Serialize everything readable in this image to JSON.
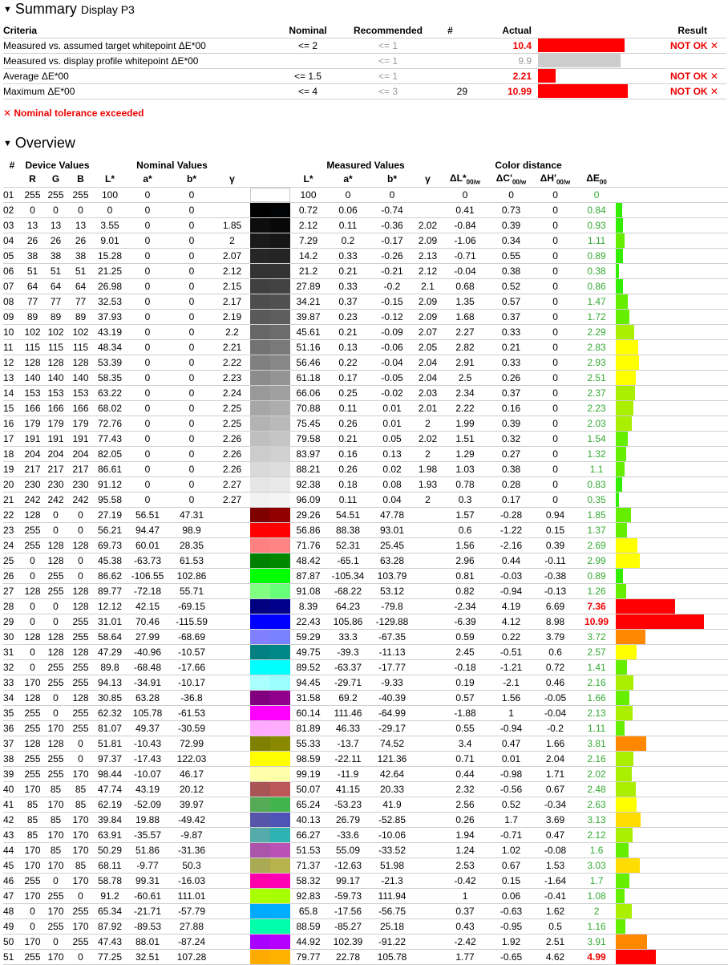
{
  "summary": {
    "title": "Summary",
    "subtitle": "Display P3",
    "headers": {
      "criteria": "Criteria",
      "nominal": "Nominal",
      "recommended": "Recommended",
      "count": "#",
      "actual": "Actual",
      "result": "Result"
    },
    "rows": [
      {
        "criteria": "Measured vs. assumed target whitepoint ΔE*00",
        "nominal": "<= 2",
        "recommended": "<= 1",
        "count": "",
        "actual": "10.4",
        "actual_status": "bad",
        "bar_color": "#ff0000",
        "bar_fraction": 0.96,
        "swatch": "",
        "result": "NOT OK ✕"
      },
      {
        "criteria": "Measured vs. display profile whitepoint ΔE*00",
        "nominal": "",
        "recommended": "<= 1",
        "count": "",
        "actual": "9.9",
        "actual_status": "muted",
        "bar_color": "#cccccc",
        "bar_fraction": 0.92,
        "swatch": "",
        "result": ""
      },
      {
        "criteria": "Average ΔE*00",
        "nominal": "<= 1.5",
        "recommended": "<= 1",
        "count": "",
        "actual": "2.21",
        "actual_status": "bad",
        "bar_color": "#ff0000",
        "bar_fraction": 0.2,
        "swatch": "",
        "result": "NOT OK ✕"
      },
      {
        "criteria": "Maximum ΔE*00",
        "nominal": "<= 4",
        "recommended": "<= 3",
        "count": "29",
        "actual": "10.99",
        "actual_status": "bad",
        "bar_color": "#ff0000",
        "bar_fraction": 1.0,
        "swatch": "blue",
        "result": "NOT OK ✕"
      }
    ],
    "note": "✕ Nominal tolerance exceeded"
  },
  "overview": {
    "title": "Overview",
    "groups": {
      "num": "#",
      "device": "Device Values",
      "nominal": "Nominal Values",
      "measured": "Measured Values",
      "distance": "Color distance"
    },
    "columns": {
      "r": "R",
      "g": "G",
      "b": "B",
      "nl": "L*",
      "na": "a*",
      "nb": "b*",
      "gamma": "γ",
      "ml": "L*",
      "ma": "a*",
      "mb": "b*",
      "mgamma": "γ",
      "dl": "ΔL*",
      "dc": "ΔC'",
      "dh": "ΔH'",
      "de": "ΔE",
      "sub_ow": "00/w",
      "sub_00": "00"
    },
    "rows": [
      [
        "01",
        "255",
        "255",
        "255",
        "100",
        "0",
        "0",
        "",
        "100",
        "0",
        "0",
        "",
        "0",
        "0",
        "0",
        "0"
      ],
      [
        "02",
        "0",
        "0",
        "0",
        "0",
        "0",
        "0",
        "",
        "0.72",
        "0.06",
        "-0.74",
        "",
        "0.41",
        "0.73",
        "0",
        "0.84"
      ],
      [
        "03",
        "13",
        "13",
        "13",
        "3.55",
        "0",
        "0",
        "1.85",
        "2.12",
        "0.11",
        "-0.36",
        "2.02",
        "-0.84",
        "0.39",
        "0",
        "0.93"
      ],
      [
        "04",
        "26",
        "26",
        "26",
        "9.01",
        "0",
        "0",
        "2",
        "7.29",
        "0.2",
        "-0.17",
        "2.09",
        "-1.06",
        "0.34",
        "0",
        "1.11"
      ],
      [
        "05",
        "38",
        "38",
        "38",
        "15.28",
        "0",
        "0",
        "2.07",
        "14.2",
        "0.33",
        "-0.26",
        "2.13",
        "-0.71",
        "0.55",
        "0",
        "0.89"
      ],
      [
        "06",
        "51",
        "51",
        "51",
        "21.25",
        "0",
        "0",
        "2.12",
        "21.2",
        "0.21",
        "-0.21",
        "2.12",
        "-0.04",
        "0.38",
        "0",
        "0.38"
      ],
      [
        "07",
        "64",
        "64",
        "64",
        "26.98",
        "0",
        "0",
        "2.15",
        "27.89",
        "0.33",
        "-0.2",
        "2.1",
        "0.68",
        "0.52",
        "0",
        "0.86"
      ],
      [
        "08",
        "77",
        "77",
        "77",
        "32.53",
        "0",
        "0",
        "2.17",
        "34.21",
        "0.37",
        "-0.15",
        "2.09",
        "1.35",
        "0.57",
        "0",
        "1.47"
      ],
      [
        "09",
        "89",
        "89",
        "89",
        "37.93",
        "0",
        "0",
        "2.19",
        "39.87",
        "0.23",
        "-0.12",
        "2.09",
        "1.68",
        "0.37",
        "0",
        "1.72"
      ],
      [
        "10",
        "102",
        "102",
        "102",
        "43.19",
        "0",
        "0",
        "2.2",
        "45.61",
        "0.21",
        "-0.09",
        "2.07",
        "2.27",
        "0.33",
        "0",
        "2.29"
      ],
      [
        "11",
        "115",
        "115",
        "115",
        "48.34",
        "0",
        "0",
        "2.21",
        "51.16",
        "0.13",
        "-0.06",
        "2.05",
        "2.82",
        "0.21",
        "0",
        "2.83"
      ],
      [
        "12",
        "128",
        "128",
        "128",
        "53.39",
        "0",
        "0",
        "2.22",
        "56.46",
        "0.22",
        "-0.04",
        "2.04",
        "2.91",
        "0.33",
        "0",
        "2.93"
      ],
      [
        "13",
        "140",
        "140",
        "140",
        "58.35",
        "0",
        "0",
        "2.23",
        "61.18",
        "0.17",
        "-0.05",
        "2.04",
        "2.5",
        "0.26",
        "0",
        "2.51"
      ],
      [
        "14",
        "153",
        "153",
        "153",
        "63.22",
        "0",
        "0",
        "2.24",
        "66.06",
        "0.25",
        "-0.02",
        "2.03",
        "2.34",
        "0.37",
        "0",
        "2.37"
      ],
      [
        "15",
        "166",
        "166",
        "166",
        "68.02",
        "0",
        "0",
        "2.25",
        "70.88",
        "0.11",
        "0.01",
        "2.01",
        "2.22",
        "0.16",
        "0",
        "2.23"
      ],
      [
        "16",
        "179",
        "179",
        "179",
        "72.76",
        "0",
        "0",
        "2.25",
        "75.45",
        "0.26",
        "0.01",
        "2",
        "1.99",
        "0.39",
        "0",
        "2.03"
      ],
      [
        "17",
        "191",
        "191",
        "191",
        "77.43",
        "0",
        "0",
        "2.26",
        "79.58",
        "0.21",
        "0.05",
        "2.02",
        "1.51",
        "0.32",
        "0",
        "1.54"
      ],
      [
        "18",
        "204",
        "204",
        "204",
        "82.05",
        "0",
        "0",
        "2.26",
        "83.97",
        "0.16",
        "0.13",
        "2",
        "1.29",
        "0.27",
        "0",
        "1.32"
      ],
      [
        "19",
        "217",
        "217",
        "217",
        "86.61",
        "0",
        "0",
        "2.26",
        "88.21",
        "0.26",
        "0.02",
        "1.98",
        "1.03",
        "0.38",
        "0",
        "1.1"
      ],
      [
        "20",
        "230",
        "230",
        "230",
        "91.12",
        "0",
        "0",
        "2.27",
        "92.38",
        "0.18",
        "0.08",
        "1.93",
        "0.78",
        "0.28",
        "0",
        "0.83"
      ],
      [
        "21",
        "242",
        "242",
        "242",
        "95.58",
        "0",
        "0",
        "2.27",
        "96.09",
        "0.11",
        "0.04",
        "2",
        "0.3",
        "0.17",
        "0",
        "0.35"
      ],
      [
        "22",
        "128",
        "0",
        "0",
        "27.19",
        "56.51",
        "47.31",
        "",
        "29.26",
        "54.51",
        "47.78",
        "",
        "1.57",
        "-0.28",
        "0.94",
        "1.85"
      ],
      [
        "23",
        "255",
        "0",
        "0",
        "56.21",
        "94.47",
        "98.9",
        "",
        "56.86",
        "88.38",
        "93.01",
        "",
        "0.6",
        "-1.22",
        "0.15",
        "1.37"
      ],
      [
        "24",
        "255",
        "128",
        "128",
        "69.73",
        "60.01",
        "28.35",
        "",
        "71.76",
        "52.31",
        "25.45",
        "",
        "1.56",
        "-2.16",
        "0.39",
        "2.69"
      ],
      [
        "25",
        "0",
        "128",
        "0",
        "45.38",
        "-63.73",
        "61.53",
        "",
        "48.42",
        "-65.1",
        "63.28",
        "",
        "2.96",
        "0.44",
        "-0.11",
        "2.99"
      ],
      [
        "26",
        "0",
        "255",
        "0",
        "86.62",
        "-106.55",
        "102.86",
        "",
        "87.87",
        "-105.34",
        "103.79",
        "",
        "0.81",
        "-0.03",
        "-0.38",
        "0.89"
      ],
      [
        "27",
        "128",
        "255",
        "128",
        "89.77",
        "-72.18",
        "55.71",
        "",
        "91.08",
        "-68.22",
        "53.12",
        "",
        "0.82",
        "-0.94",
        "-0.13",
        "1.26"
      ],
      [
        "28",
        "0",
        "0",
        "128",
        "12.12",
        "42.15",
        "-69.15",
        "",
        "8.39",
        "64.23",
        "-79.8",
        "",
        "-2.34",
        "4.19",
        "6.69",
        "7.36"
      ],
      [
        "29",
        "0",
        "0",
        "255",
        "31.01",
        "70.46",
        "-115.59",
        "",
        "22.43",
        "105.86",
        "-129.88",
        "",
        "-6.39",
        "4.12",
        "8.98",
        "10.99"
      ],
      [
        "30",
        "128",
        "128",
        "255",
        "58.64",
        "27.99",
        "-68.69",
        "",
        "59.29",
        "33.3",
        "-67.35",
        "",
        "0.59",
        "0.22",
        "3.79",
        "3.72"
      ],
      [
        "31",
        "0",
        "128",
        "128",
        "47.29",
        "-40.96",
        "-10.57",
        "",
        "49.75",
        "-39.3",
        "-11.13",
        "",
        "2.45",
        "-0.51",
        "0.6",
        "2.57"
      ],
      [
        "32",
        "0",
        "255",
        "255",
        "89.8",
        "-68.48",
        "-17.66",
        "",
        "89.52",
        "-63.37",
        "-17.77",
        "",
        "-0.18",
        "-1.21",
        "0.72",
        "1.41"
      ],
      [
        "33",
        "170",
        "255",
        "255",
        "94.13",
        "-34.91",
        "-10.17",
        "",
        "94.45",
        "-29.71",
        "-9.33",
        "",
        "0.19",
        "-2.1",
        "0.46",
        "2.16"
      ],
      [
        "34",
        "128",
        "0",
        "128",
        "30.85",
        "63.28",
        "-36.8",
        "",
        "31.58",
        "69.2",
        "-40.39",
        "",
        "0.57",
        "1.56",
        "-0.05",
        "1.66"
      ],
      [
        "35",
        "255",
        "0",
        "255",
        "62.32",
        "105.78",
        "-61.53",
        "",
        "60.14",
        "111.46",
        "-64.99",
        "",
        "-1.88",
        "1",
        "-0.04",
        "2.13"
      ],
      [
        "36",
        "255",
        "170",
        "255",
        "81.07",
        "49.37",
        "-30.59",
        "",
        "81.89",
        "46.33",
        "-29.17",
        "",
        "0.55",
        "-0.94",
        "-0.2",
        "1.11"
      ],
      [
        "37",
        "128",
        "128",
        "0",
        "51.81",
        "-10.43",
        "72.99",
        "",
        "55.33",
        "-13.7",
        "74.52",
        "",
        "3.4",
        "0.47",
        "1.66",
        "3.81"
      ],
      [
        "38",
        "255",
        "255",
        "0",
        "97.37",
        "-17.43",
        "122.03",
        "",
        "98.59",
        "-22.11",
        "121.36",
        "",
        "0.71",
        "0.01",
        "2.04",
        "2.16"
      ],
      [
        "39",
        "255",
        "255",
        "170",
        "98.44",
        "-10.07",
        "46.17",
        "",
        "99.19",
        "-11.9",
        "42.64",
        "",
        "0.44",
        "-0.98",
        "1.71",
        "2.02"
      ],
      [
        "40",
        "170",
        "85",
        "85",
        "47.74",
        "43.19",
        "20.12",
        "",
        "50.07",
        "41.15",
        "20.33",
        "",
        "2.32",
        "-0.56",
        "0.67",
        "2.48"
      ],
      [
        "41",
        "85",
        "170",
        "85",
        "62.19",
        "-52.09",
        "39.97",
        "",
        "65.24",
        "-53.23",
        "41.9",
        "",
        "2.56",
        "0.52",
        "-0.34",
        "2.63"
      ],
      [
        "42",
        "85",
        "85",
        "170",
        "39.84",
        "19.88",
        "-49.42",
        "",
        "40.13",
        "26.79",
        "-52.85",
        "",
        "0.26",
        "1.7",
        "3.69",
        "3.13"
      ],
      [
        "43",
        "85",
        "170",
        "170",
        "63.91",
        "-35.57",
        "-9.87",
        "",
        "66.27",
        "-33.6",
        "-10.06",
        "",
        "1.94",
        "-0.71",
        "0.47",
        "2.12"
      ],
      [
        "44",
        "170",
        "85",
        "170",
        "50.29",
        "51.86",
        "-31.36",
        "",
        "51.53",
        "55.09",
        "-33.52",
        "",
        "1.24",
        "1.02",
        "-0.08",
        "1.6"
      ],
      [
        "45",
        "170",
        "170",
        "85",
        "68.11",
        "-9.77",
        "50.3",
        "",
        "71.37",
        "-12.63",
        "51.98",
        "",
        "2.53",
        "0.67",
        "1.53",
        "3.03"
      ],
      [
        "46",
        "255",
        "0",
        "170",
        "58.78",
        "99.31",
        "-16.03",
        "",
        "58.32",
        "99.17",
        "-21.3",
        "",
        "-0.42",
        "0.15",
        "-1.64",
        "1.7"
      ],
      [
        "47",
        "170",
        "255",
        "0",
        "91.2",
        "-60.61",
        "111.01",
        "",
        "92.83",
        "-59.73",
        "111.94",
        "",
        "1",
        "0.06",
        "-0.41",
        "1.08"
      ],
      [
        "48",
        "0",
        "170",
        "255",
        "65.34",
        "-21.71",
        "-57.79",
        "",
        "65.8",
        "-17.56",
        "-56.75",
        "",
        "0.37",
        "-0.63",
        "1.62",
        "2"
      ],
      [
        "49",
        "0",
        "255",
        "170",
        "87.92",
        "-89.53",
        "27.88",
        "",
        "88.59",
        "-85.27",
        "25.18",
        "",
        "0.43",
        "-0.95",
        "0.5",
        "1.16"
      ],
      [
        "50",
        "170",
        "0",
        "255",
        "47.43",
        "88.01",
        "-87.24",
        "",
        "44.92",
        "102.39",
        "-91.22",
        "",
        "-2.42",
        "1.92",
        "2.51",
        "3.91"
      ],
      [
        "51",
        "255",
        "170",
        "0",
        "77.25",
        "32.51",
        "107.28",
        "",
        "79.77",
        "22.78",
        "105.78",
        "",
        "1.77",
        "-0.65",
        "4.62",
        "4.99"
      ]
    ]
  }
}
